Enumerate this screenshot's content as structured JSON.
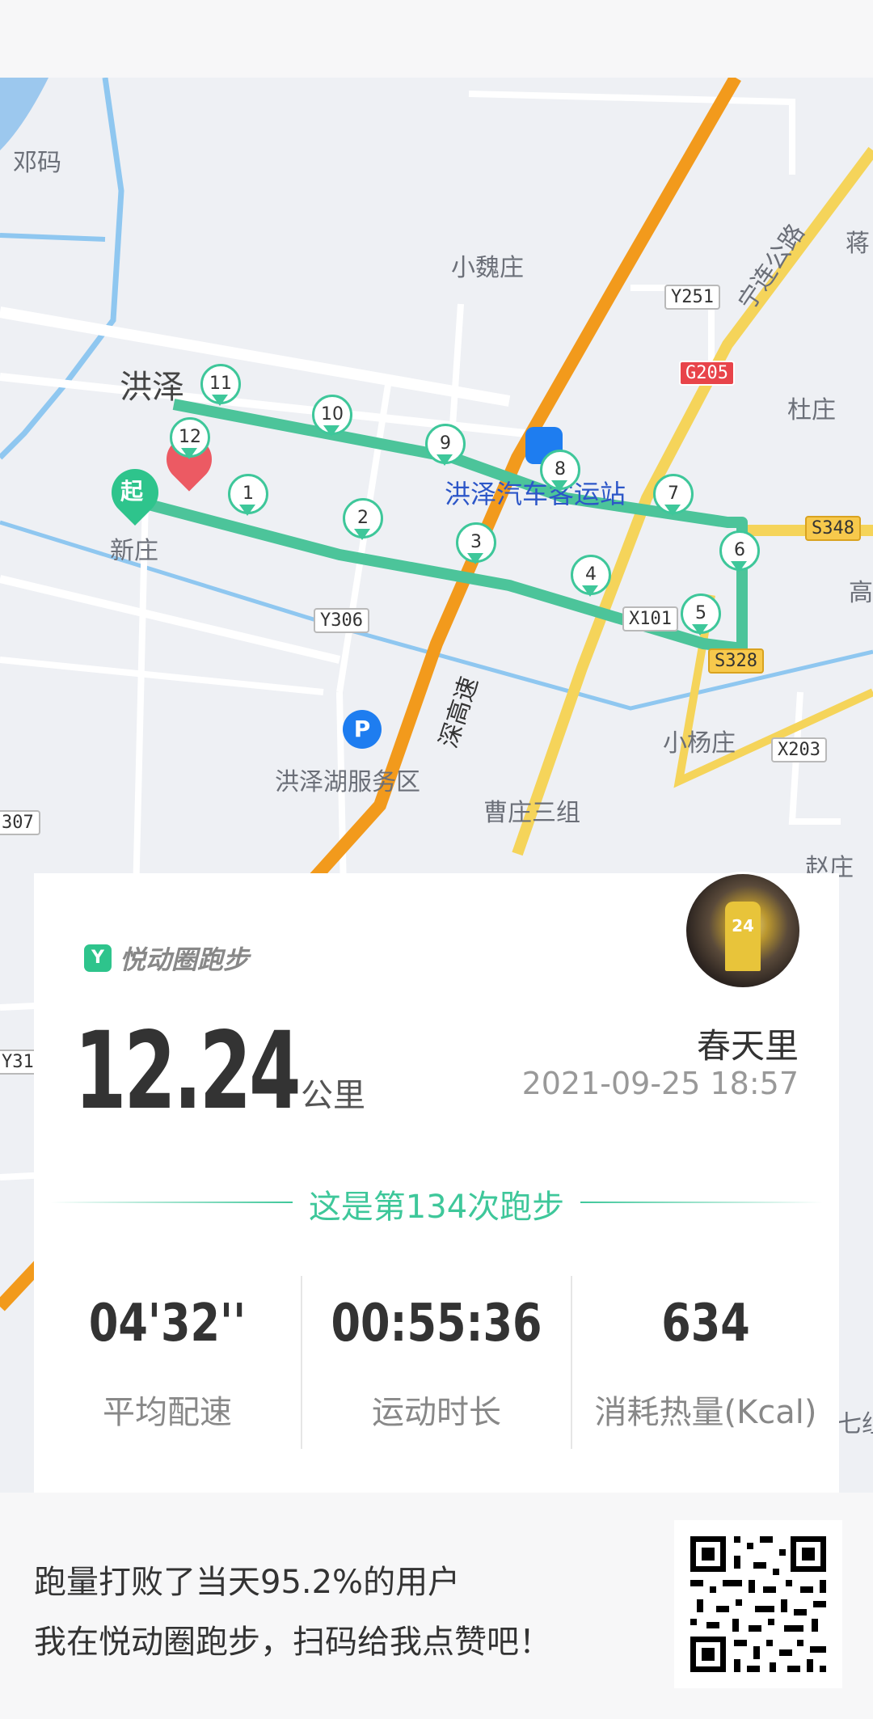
{
  "map": {
    "places": [
      "邓码",
      "小魏庄",
      "洪泽",
      "新庄",
      "杜庄",
      "小杨庄",
      "曹庄三组",
      "洪泽湖服务区",
      "洪泽汽车客运站",
      "赵庄",
      "蒋",
      "高",
      "七组",
      "宁连公路",
      "深高速"
    ],
    "road_signs": [
      "Y251",
      "G205",
      "S348",
      "Y306",
      "X101",
      "S328",
      "X203",
      "307",
      "Y31"
    ],
    "start_label": "起",
    "kilometer_markers": [
      "1",
      "2",
      "3",
      "4",
      "5",
      "6",
      "7",
      "8",
      "9",
      "10",
      "11",
      "12"
    ]
  },
  "card": {
    "app_name": "悦动圈跑步",
    "distance": "12.24",
    "unit": "公里",
    "username": "春天里",
    "datetime": "2021-09-25 18:57",
    "run_count_text": "这是第134次跑步",
    "stats": [
      {
        "value": "04'32''",
        "label": "平均配速"
      },
      {
        "value": "00:55:36",
        "label": "运动时长"
      },
      {
        "value": "634",
        "label": "消耗热量(Kcal)"
      }
    ]
  },
  "footer": {
    "line1": "跑量打败了当天95.2%的用户",
    "line2": "我在悦动圈跑步，扫码给我点赞吧！"
  },
  "colors": {
    "accent": "#3ec79a",
    "route": "#4cc49a",
    "highway": "#f29a1c",
    "road_yellow": "#f5d45a",
    "water": "#8fc7f0"
  }
}
